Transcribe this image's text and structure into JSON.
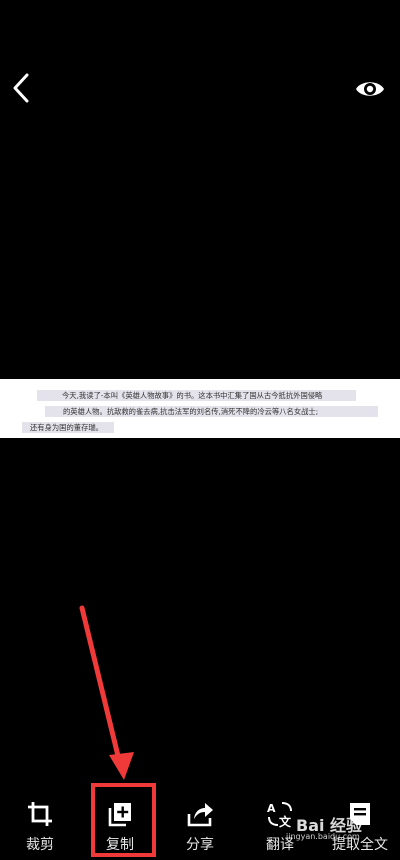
{
  "header": {
    "back_icon": "chevron-left-icon",
    "preview_icon": "eye-icon"
  },
  "document": {
    "lines": [
      "今天,我读了-本叫《英雄人物故事》的书。这本书中汇集了国从古今抵抗外国侵略",
      "的英雄人物。抗敌救的雀去病,抗击法军的刘名传,消死不降的冷云等八名女战士;",
      "还有身为国的董存瑞。"
    ]
  },
  "toolbar": {
    "items": [
      {
        "label": "裁剪",
        "icon": "crop-icon"
      },
      {
        "label": "复制",
        "icon": "copy-icon"
      },
      {
        "label": "分享",
        "icon": "share-icon"
      },
      {
        "label": "翻译",
        "icon": "translate-icon"
      },
      {
        "label": "提取全文",
        "icon": "document-icon"
      }
    ]
  },
  "annotation": {
    "color": "#f03a3a"
  },
  "watermark": {
    "brand": "Bai 经验",
    "url": "jingyan.baidu.com"
  }
}
